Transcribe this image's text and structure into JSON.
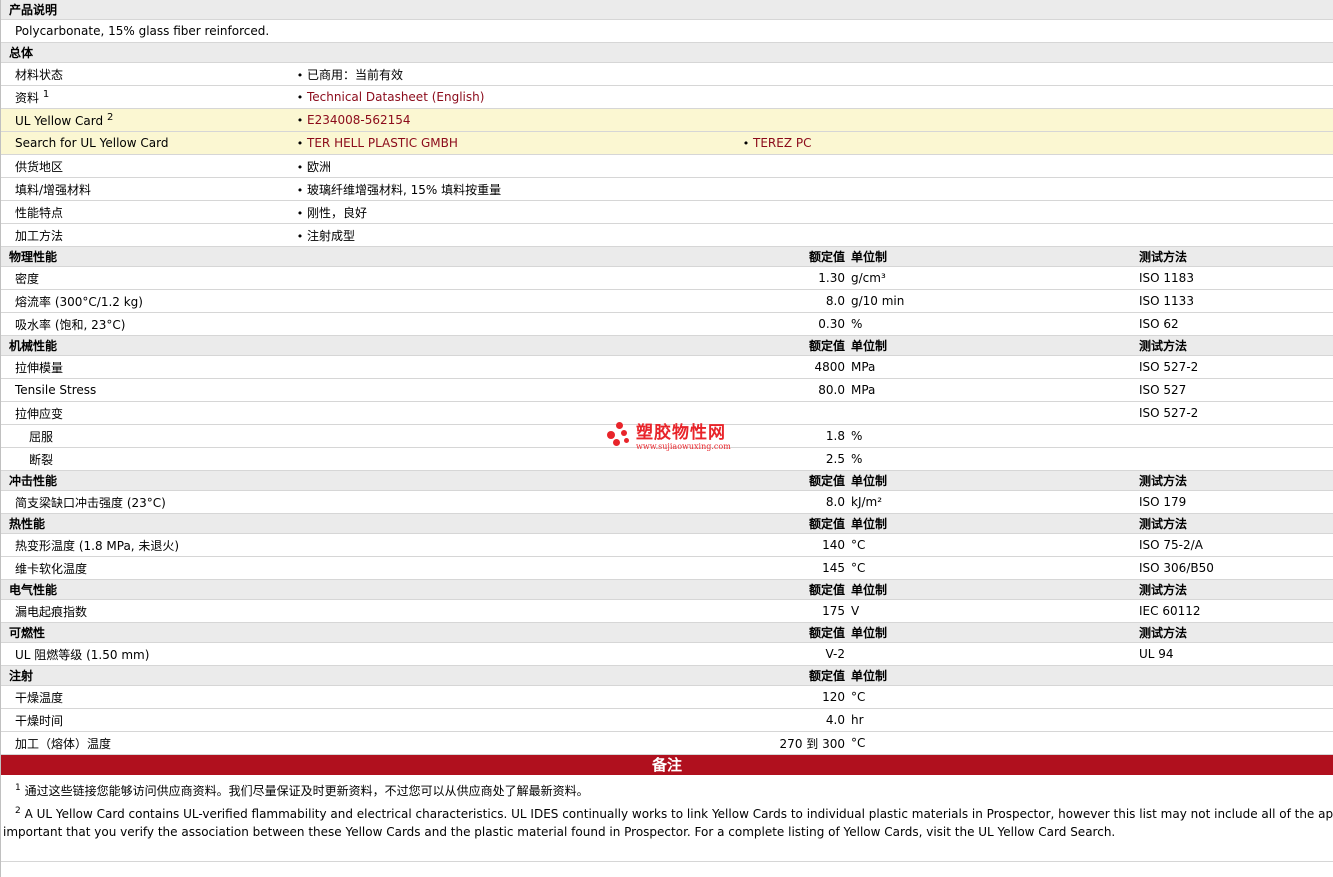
{
  "description": {
    "header": "产品说明",
    "text": "Polycarbonate, 15% glass fiber reinforced."
  },
  "general": {
    "header": "总体",
    "status": {
      "label": "材料状态",
      "value": "已商用：当前有效"
    },
    "docs": {
      "label": "资料",
      "sup": "1",
      "value": "Technical Datasheet (English)"
    },
    "ulcard": {
      "label": "UL Yellow Card",
      "sup": "2",
      "value": "E234008-562154"
    },
    "ulsearch": {
      "label": "Search for UL Yellow Card",
      "value1": "TER HELL PLASTIC GMBH",
      "value2": "TEREZ PC"
    },
    "region": {
      "label": "供货地区",
      "value": "欧洲"
    },
    "filler": {
      "label": "填料/增强材料",
      "value": "玻璃纤维增强材料, 15% 填料按重量"
    },
    "features": {
      "label": "性能特点",
      "value": "刚性，良好"
    },
    "processing": {
      "label": "加工方法",
      "value": "注射成型"
    }
  },
  "headers": {
    "nominal": "额定值",
    "unit": "单位制",
    "method": "测试方法"
  },
  "physical": {
    "header": "物理性能",
    "rows": [
      {
        "label": "密度",
        "value": "1.30",
        "unit": "g/cm³",
        "method": "ISO 1183"
      },
      {
        "label": "熔流率 (300°C/1.2 kg)",
        "value": "8.0",
        "unit": "g/10 min",
        "method": "ISO 1133"
      },
      {
        "label": "吸水率 (饱和, 23°C)",
        "value": "0.30",
        "unit": "%",
        "method": "ISO 62"
      }
    ]
  },
  "mechanical": {
    "header": "机械性能",
    "rows": [
      {
        "label": "拉伸模量",
        "value": "4800",
        "unit": "MPa",
        "method": "ISO 527-2"
      },
      {
        "label": "Tensile Stress",
        "value": "80.0",
        "unit": "MPa",
        "method": "ISO 527"
      },
      {
        "label": "拉伸应变",
        "value": "",
        "unit": "",
        "method": "ISO 527-2"
      },
      {
        "label": "屈服",
        "value": "1.8",
        "unit": "%",
        "method": ""
      },
      {
        "label": "断裂",
        "value": "2.5",
        "unit": "%",
        "method": ""
      }
    ]
  },
  "impact": {
    "header": "冲击性能",
    "rows": [
      {
        "label": "简支梁缺口冲击强度 (23°C)",
        "value": "8.0",
        "unit": "kJ/m²",
        "method": "ISO 179"
      }
    ]
  },
  "thermal": {
    "header": "热性能",
    "rows": [
      {
        "label": "热变形温度 (1.8 MPa, 未退火)",
        "value": "140",
        "unit": "°C",
        "method": "ISO 75-2/A"
      },
      {
        "label": "维卡软化温度",
        "value": "145",
        "unit": "°C",
        "method": "ISO 306/B50"
      }
    ]
  },
  "electrical": {
    "header": "电气性能",
    "rows": [
      {
        "label": "漏电起痕指数",
        "value": "175",
        "unit": "V",
        "method": "IEC 60112"
      }
    ]
  },
  "flammability": {
    "header": "可燃性",
    "rows": [
      {
        "label": "UL 阻燃等级 (1.50 mm)",
        "value": "V-2",
        "unit": "",
        "method": "UL 94"
      }
    ]
  },
  "injection": {
    "header": "注射",
    "rows": [
      {
        "label": "干燥温度",
        "value": "120",
        "unit": "°C"
      },
      {
        "label": "干燥时间",
        "value": "4.0",
        "unit": "hr"
      },
      {
        "label": "加工（熔体）温度",
        "value": "270 到  300",
        "unit": "°C"
      }
    ]
  },
  "notes": {
    "header": "备注",
    "fn1_num": "1",
    "fn1": "通过这些链接您能够访问供应商资料。我们尽量保证及时更新资料，不过您可以从供应商处了解最新资料。",
    "fn2_num": "2",
    "fn2a": "A UL Yellow Card contains UL-verified flammability and electrical characteristics. UL IDES continually works to link Yellow Cards to individual plastic materials in Prospector, however this list may not include all of the appropriate",
    "fn2b": "important that you verify the association between these Yellow Cards and the plastic material found in Prospector. For a complete listing of Yellow Cards, visit the UL Yellow Card Search."
  },
  "watermark": {
    "name": "塑胶物性网",
    "url": "www.sujiaowuxing.com",
    "color": "#e8242a"
  }
}
